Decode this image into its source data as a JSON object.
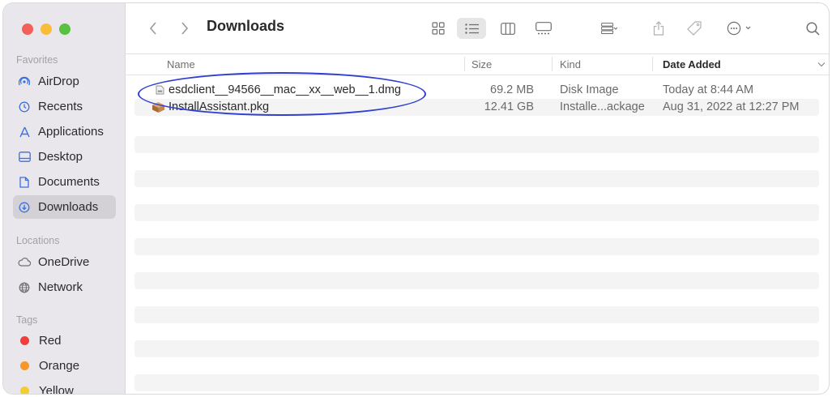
{
  "window": {
    "title": "Downloads"
  },
  "sidebar": {
    "favorites_label": "Favorites",
    "favorites": [
      {
        "label": "AirDrop",
        "icon": "airdrop-icon"
      },
      {
        "label": "Recents",
        "icon": "clock-icon"
      },
      {
        "label": "Applications",
        "icon": "applications-icon"
      },
      {
        "label": "Desktop",
        "icon": "desktop-icon"
      },
      {
        "label": "Documents",
        "icon": "document-icon"
      },
      {
        "label": "Downloads",
        "icon": "download-icon",
        "selected": true
      }
    ],
    "locations_label": "Locations",
    "locations": [
      {
        "label": "OneDrive",
        "icon": "cloud-icon"
      },
      {
        "label": "Network",
        "icon": "globe-icon"
      }
    ],
    "tags_label": "Tags",
    "tags": [
      {
        "label": "Red",
        "color": "#f23d3a"
      },
      {
        "label": "Orange",
        "color": "#f5972b"
      },
      {
        "label": "Yellow",
        "color": "#f5cd2a"
      }
    ]
  },
  "columns": {
    "name": "Name",
    "size": "Size",
    "kind": "Kind",
    "date_added": "Date Added"
  },
  "files": [
    {
      "name": "esdclient__94566__mac__xx__web__1.dmg",
      "size": "69.2 MB",
      "kind": "Disk Image",
      "date_added": "Today at 8:44 AM",
      "icon": "disk-image-icon"
    },
    {
      "name": "InstallAssistant.pkg",
      "size": "12.41 GB",
      "kind": "Installe...ackage",
      "date_added": "Aug 31, 2022 at 12:27 PM",
      "icon": "package-icon"
    }
  ],
  "colors": {
    "annotation": "#2f3fd1",
    "sidebar_bg": "#e9e7ec"
  }
}
